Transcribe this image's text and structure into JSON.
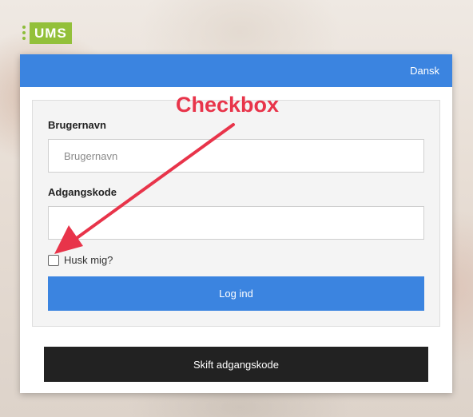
{
  "logo": {
    "text": "UMS"
  },
  "header": {
    "language": "Dansk"
  },
  "form": {
    "username_label": "Brugernavn",
    "username_placeholder": "Brugernavn",
    "username_value": "",
    "password_label": "Adgangskode",
    "password_value": "",
    "remember_label": "Husk mig?",
    "remember_checked": false,
    "login_button": "Log ind"
  },
  "change_password_button": "Skift adgangskode",
  "annotation": {
    "text": "Checkbox",
    "color": "#e8344a"
  },
  "colors": {
    "primary": "#3b84e0",
    "logo_green": "#93c03a",
    "dark_button": "#222222"
  }
}
